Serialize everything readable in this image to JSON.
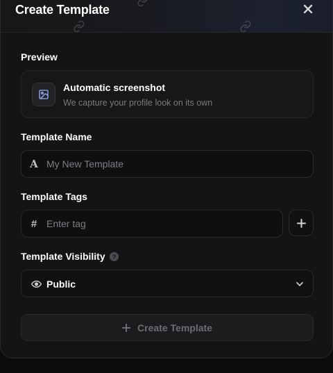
{
  "header": {
    "title": "Create Template",
    "close_icon": "close-icon"
  },
  "preview": {
    "section_label": "Preview",
    "icon": "image-icon",
    "title": "Automatic screenshot",
    "subtitle": "We capture your profile look on its own"
  },
  "template_name": {
    "label": "Template Name",
    "icon": "text-icon",
    "icon_glyph": "A",
    "value": "",
    "placeholder": "My New Template"
  },
  "template_tags": {
    "label": "Template Tags",
    "icon": "hash-icon",
    "icon_glyph": "#",
    "value": "",
    "placeholder": "Enter tag",
    "add_icon": "plus-icon"
  },
  "visibility": {
    "label": "Template Visibility",
    "help_icon": "help-icon",
    "help_glyph": "?",
    "icon": "eye-icon",
    "selected": "Public",
    "chevron_icon": "chevron-down-icon"
  },
  "submit": {
    "icon": "plus-icon",
    "label": "Create Template"
  },
  "colors": {
    "modal_bg": "#141415",
    "border": "#2a2a2d",
    "text": "#ffffff",
    "muted": "#7a7a80",
    "disabled_text": "#6c6c72"
  }
}
